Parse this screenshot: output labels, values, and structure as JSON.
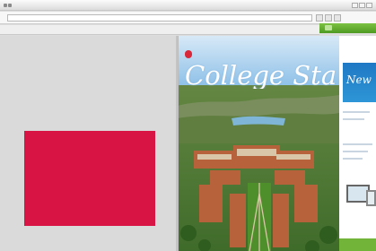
{
  "browser": {
    "window_title": "",
    "address": "",
    "green_tab_label": "",
    "menu": [
      "",
      "",
      "",
      "",
      "",
      "",
      "",
      "",
      "",
      "",
      "",
      "",
      ""
    ]
  },
  "document": {
    "magazine": {
      "logo": "",
      "date": "",
      "title": "College Station",
      "subtitle": "",
      "blurb": ""
    },
    "sidebar": {
      "promo": "New",
      "footer": ""
    }
  },
  "colors": {
    "red_block": "#d81444",
    "green_accent": "#6bb33a",
    "promo_blue": "#1f78c4"
  },
  "icons": [
    "window-control-icons",
    "navigation-icons",
    "magazine-logo"
  ]
}
